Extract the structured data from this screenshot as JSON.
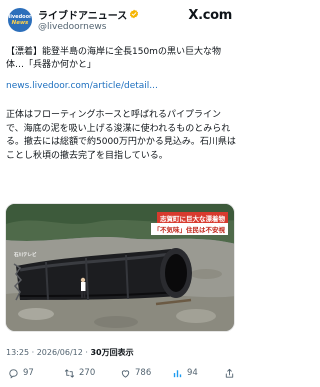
{
  "account": {
    "name": "ライブドアニュース",
    "handle": "@livedoornews",
    "avatar_top": "livedoor",
    "avatar_bottom": "News"
  },
  "platform_logo": "X.com",
  "tweet": {
    "title": "【漂着】能登半島の海岸に全長150mの黒い巨大な物体…「兵器か何かと」",
    "link": "news.livedoor.com/article/detail...",
    "body": "正体はフローティングホースと呼ばれるパイプラインで、海底の泥を吸い上げる浚渫に使われるものとみられる。撤去には総額で約5000万円かかる見込み。石川県はことし秋頃の撤去完了を目指している。"
  },
  "media": {
    "caption_line1": "志賀町に巨大な漂着物",
    "caption_line2": "「不気味」住民は不安視",
    "tv_logo": "石川テレビ"
  },
  "meta": {
    "time": "13:25",
    "date": "2026/06/12",
    "views": "30万回表示",
    "separator": "·"
  },
  "actions": {
    "replies": "97",
    "retweets": "270",
    "likes": "786",
    "views": "94"
  },
  "colors": {
    "link": "#1d6fbf",
    "secondary_text": "#536471",
    "verified": "#f5b400",
    "caption_red": "#d83a2e"
  }
}
